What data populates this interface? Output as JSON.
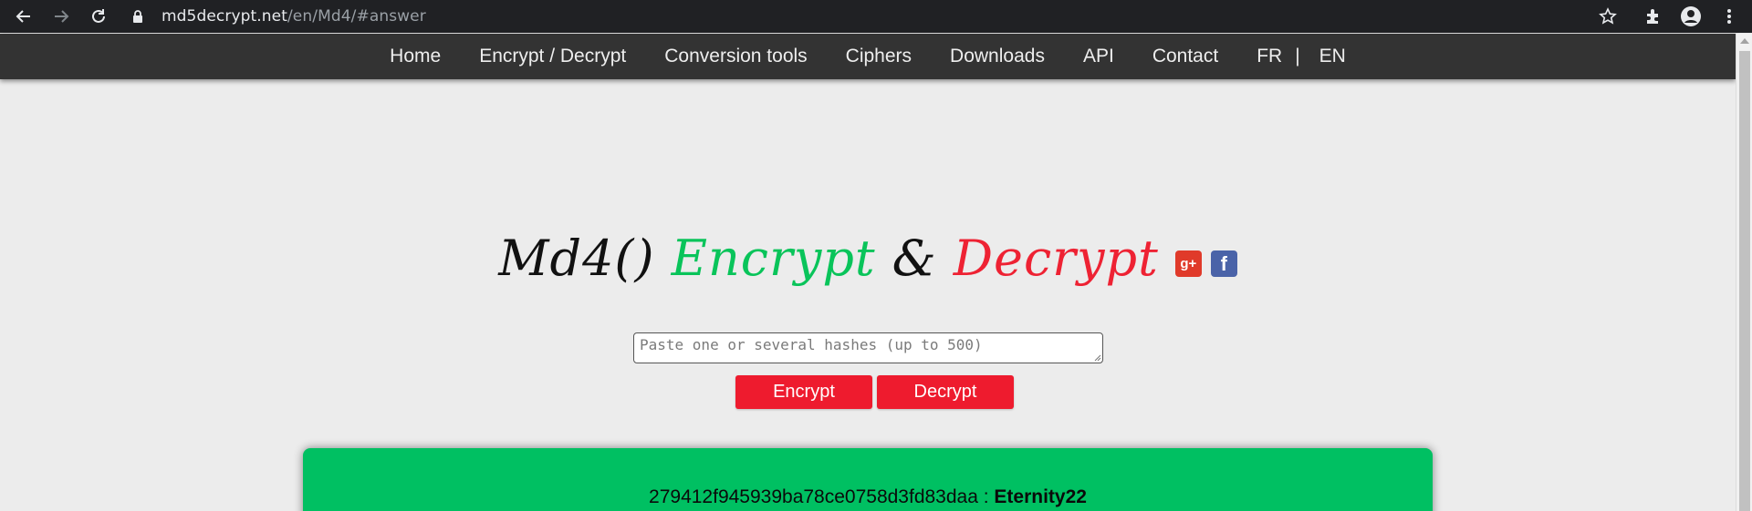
{
  "browser": {
    "url_host": "md5decrypt.net",
    "url_path": "/en/Md4/#answer",
    "icons": [
      "back-icon",
      "forward-icon",
      "reload-icon",
      "lock-icon",
      "star-icon",
      "extensions-icon",
      "profile-icon",
      "menu-icon"
    ]
  },
  "nav": {
    "items": [
      "Home",
      "Encrypt / Decrypt",
      "Conversion tools",
      "Ciphers",
      "Downloads",
      "API",
      "Contact",
      "FR"
    ],
    "separator": "|",
    "last": "EN"
  },
  "title": {
    "part1": "Md4()",
    "part2": "Encrypt",
    "part3": "&",
    "part4": "Decrypt",
    "colors": {
      "encrypt": "#09c45a",
      "decrypt": "#ee2233"
    }
  },
  "social": {
    "googleplus": "g+",
    "facebook": "f"
  },
  "form": {
    "placeholder": "Paste one or several hashes (up to 500)",
    "value": "",
    "encrypt_label": "Encrypt",
    "decrypt_label": "Decrypt",
    "button_color": "#ee1b2e"
  },
  "result": {
    "hash": "279412f945939ba78ce0758d3fd83daa",
    "separator": " : ",
    "plaintext": "Eternity22",
    "color": "#00c062"
  }
}
